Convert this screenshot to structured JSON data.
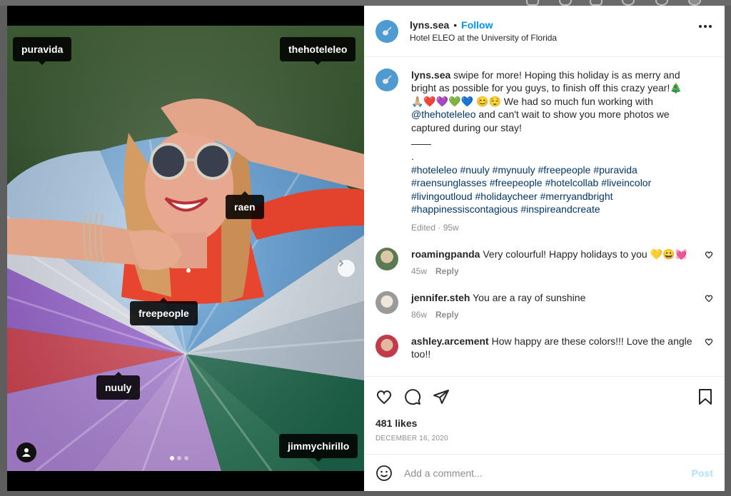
{
  "post": {
    "username": "lyns.sea",
    "separator": "•",
    "follow_label": "Follow",
    "location": "Hotel ELEO at the University of Florida",
    "caption": {
      "username": "lyns.sea",
      "text_1": "swipe for more! Hoping this holiday is as merry and bright as possible for you guys, to finish off this crazy year!🎄🙏🏼❤️💜💚💙 😊😌 We had so much fun working with",
      "mention": "@thehoteleleo",
      "text_2": "and can't wait to show you more photos we captured during our stay!",
      "divider": "——",
      "dot": ".",
      "hashtags": [
        "#hoteleleo",
        "#nuuly",
        "#mynuuly",
        "#freepeople",
        "#puravida",
        "#raensunglasses",
        "#freepeople",
        "#hotelcollab",
        "#liveincolor",
        "#livingoutloud",
        "#holidaycheer",
        "#merryandbright",
        "#happinessiscontagious",
        "#inspireandcreate"
      ],
      "edited": "Edited · 95w"
    },
    "comments": [
      {
        "username": "roamingpanda",
        "text": "Very colourful! Happy holidays to you 💛😀💓",
        "time": "45w",
        "reply": "Reply"
      },
      {
        "username": "jennifer.steh",
        "text": "You are a ray of sunshine",
        "time": "86w",
        "reply": "Reply"
      },
      {
        "username": "ashley.arcement",
        "text": "How happy are these colors!!! Love the angle too!!",
        "time": "",
        "reply": ""
      }
    ],
    "likes": "481 likes",
    "date": "DECEMBER 16, 2020",
    "add_comment_placeholder": "Add a comment...",
    "post_label": "Post"
  },
  "media": {
    "tags": [
      "puravida",
      "thehoteleleo",
      "raen",
      "freepeople",
      "nuuly",
      "jimmychirillo"
    ],
    "carousel_active_index": 0,
    "carousel_count": 3
  },
  "colors": {
    "follow": "#0095f6",
    "link": "#00376b",
    "post_disabled": "#b2dffc"
  }
}
